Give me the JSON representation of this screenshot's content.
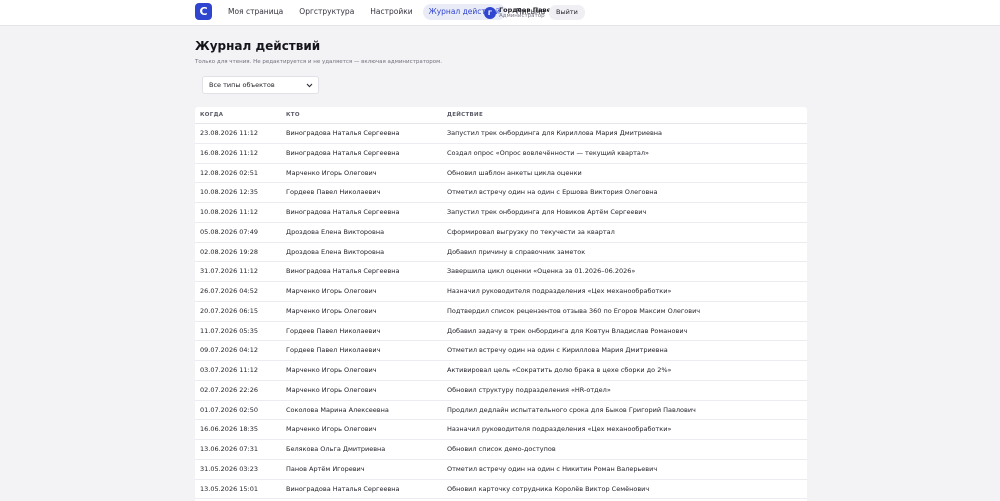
{
  "header": {
    "logo_letter": "C",
    "nav": [
      {
        "label": "Моя страница",
        "active": false
      },
      {
        "label": "Оргструктура",
        "active": false
      },
      {
        "label": "Настройки",
        "active": false
      },
      {
        "label": "Журнал действий",
        "active": true
      },
      {
        "label": "Письма",
        "active": false
      }
    ],
    "user": {
      "initial": "Г",
      "name": "Гордеев Павел",
      "role": "Администратор"
    },
    "logout_label": "Выйти"
  },
  "page": {
    "title": "Журнал действий",
    "subtitle": "Только для чтения. Не редактируется и не удаляется — включая администратором."
  },
  "filter": {
    "selected": "Все типы объектов"
  },
  "table": {
    "columns": [
      "КОГДА",
      "КТО",
      "ДЕЙСТВИЕ"
    ],
    "rows": [
      [
        "23.08.2026 11:12",
        "Виноградова Наталья Сергеевна",
        "Запустил трек онбординга для Кириллова Мария Дмитриевна"
      ],
      [
        "16.08.2026 11:12",
        "Виноградова Наталья Сергеевна",
        "Создал опрос «Опрос вовлечённости — текущий квартал»"
      ],
      [
        "12.08.2026 02:51",
        "Марченко Игорь Олегович",
        "Обновил шаблон анкеты цикла оценки"
      ],
      [
        "10.08.2026 12:35",
        "Гордеев Павел Николаевич",
        "Отметил встречу один на один с Ершова Виктория Олеговна"
      ],
      [
        "10.08.2026 11:12",
        "Виноградова Наталья Сергеевна",
        "Запустил трек онбординга для Новиков Артём Сергеевич"
      ],
      [
        "05.08.2026 07:49",
        "Дроздова Елена Викторовна",
        "Сформировал выгрузку по текучести за квартал"
      ],
      [
        "02.08.2026 19:28",
        "Дроздова Елена Викторовна",
        "Добавил причину в справочник заметок"
      ],
      [
        "31.07.2026 11:12",
        "Виноградова Наталья Сергеевна",
        "Завершила цикл оценки «Оценка за 01.2026–06.2026»"
      ],
      [
        "26.07.2026 04:52",
        "Марченко Игорь Олегович",
        "Назначил руководителя подразделения «Цех механообработки»"
      ],
      [
        "20.07.2026 06:15",
        "Марченко Игорь Олегович",
        "Подтвердил список рецензентов отзыва 360 по Егоров Максим Олегович"
      ],
      [
        "11.07.2026 05:35",
        "Гордеев Павел Николаевич",
        "Добавил задачу в трек онбординга для Ковтун Владислав Романович"
      ],
      [
        "09.07.2026 04:12",
        "Гордеев Павел Николаевич",
        "Отметил встречу один на один с Кириллова Мария Дмитриевна"
      ],
      [
        "03.07.2026 11:12",
        "Марченко Игорь Олегович",
        "Активировал цель «Сократить долю брака в цехе сборки до 2%»"
      ],
      [
        "02.07.2026 22:26",
        "Марченко Игорь Олегович",
        "Обновил структуру подразделения «HR-отдел»"
      ],
      [
        "01.07.2026 02:50",
        "Соколова Марина Алексеевна",
        "Продлил дедлайн испытательного срока для Быков Григорий Павлович"
      ],
      [
        "16.06.2026 18:35",
        "Марченко Игорь Олегович",
        "Назначил руководителя подразделения «Цех механообработки»"
      ],
      [
        "13.06.2026 07:31",
        "Белякова Ольга Дмитриевна",
        "Обновил список демо-доступов"
      ],
      [
        "31.05.2026 03:23",
        "Панов Артём Игоревич",
        "Отметил встречу один на один с Никитин Роман Валерьевич"
      ],
      [
        "13.05.2026 15:01",
        "Виноградова Наталья Сергеевна",
        "Обновил карточку сотрудника Королёв Виктор Семёнович"
      ]
    ]
  }
}
